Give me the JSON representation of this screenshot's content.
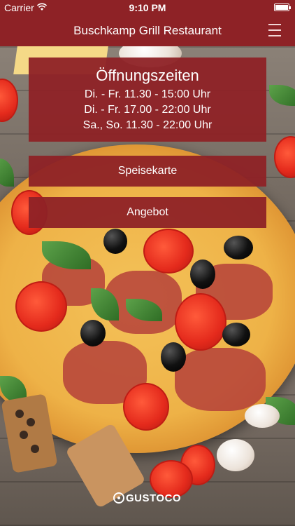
{
  "status_bar": {
    "carrier": "Carrier",
    "time": "9:10 PM"
  },
  "nav": {
    "title": "Buschkamp Grill Restaurant",
    "menu_icon": "hamburger-menu-icon"
  },
  "opening_hours": {
    "title": "Öffnungszeiten",
    "lines": [
      "Di. - Fr. 11.30 - 15:00 Uhr",
      "Di. - Fr. 17.00 - 22:00 Uhr",
      "Sa., So. 11.30 - 22:00 Uhr"
    ]
  },
  "buttons": {
    "menu_label": "Speisekarte",
    "offer_label": "Angebot"
  },
  "brand": {
    "name": "GUSTOCO"
  },
  "colors": {
    "primary": "#8e2226",
    "text": "#ffffff"
  }
}
